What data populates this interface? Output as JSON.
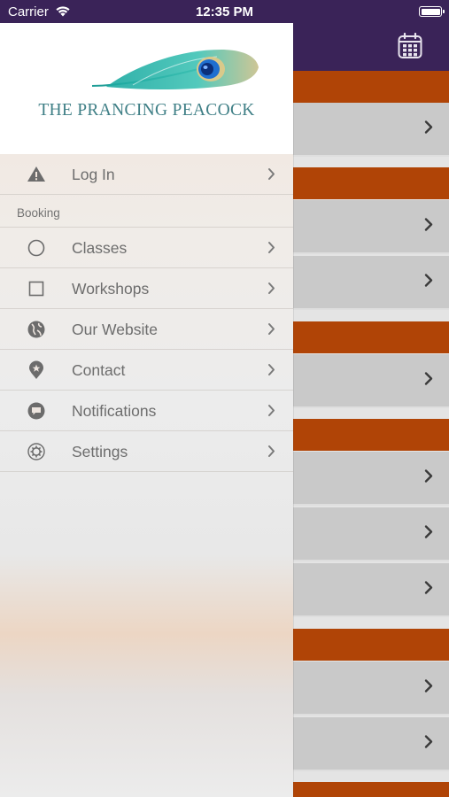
{
  "status_bar": {
    "carrier": "Carrier",
    "time": "12:35 PM"
  },
  "header": {
    "calendar_icon": "calendar-icon"
  },
  "brand": {
    "name": "THE PRANCING PEACOCK",
    "logo_icon": "peacock-feather-logo"
  },
  "menu": {
    "login": {
      "label": "Log In",
      "icon": "warning-triangle-icon"
    },
    "section_label": "Booking",
    "items": [
      {
        "label": "Classes",
        "icon": "circle-outline-icon"
      },
      {
        "label": "Workshops",
        "icon": "square-outline-icon"
      },
      {
        "label": "Our Website",
        "icon": "globe-icon"
      },
      {
        "label": "Contact",
        "icon": "location-pin-icon"
      },
      {
        "label": "Notifications",
        "icon": "chat-bubble-icon"
      },
      {
        "label": "Settings",
        "icon": "gear-icon"
      }
    ]
  },
  "colors": {
    "navbar": "#3a2358",
    "section_header": "#b04406",
    "logo_text": "#3f7f86",
    "menu_text": "#6d6d6d"
  }
}
